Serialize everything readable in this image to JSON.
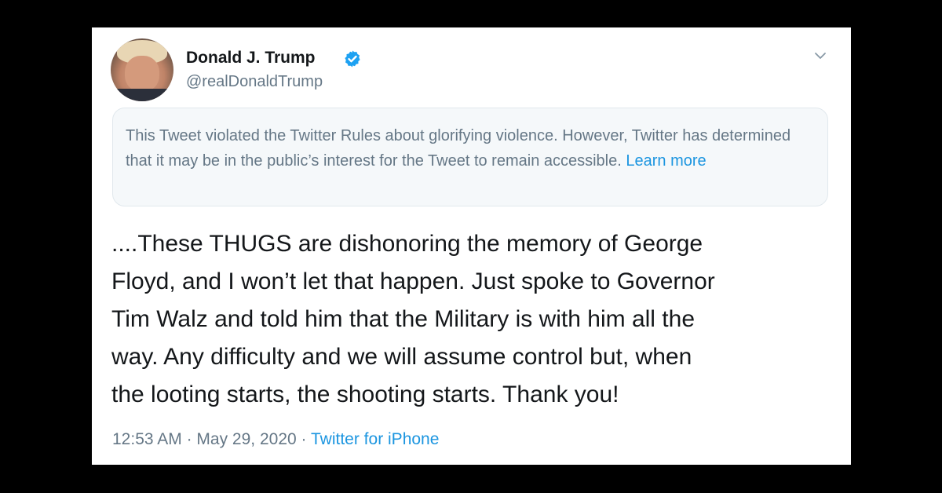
{
  "tweet": {
    "author": {
      "display_name": "Donald J. Trump",
      "handle": "@realDonaldTrump",
      "verified_icon": "verified-badge-icon",
      "avatar": "profile-photo"
    },
    "menu_icon": "chevron-down-icon",
    "notice": {
      "text": "This Tweet violated the Twitter Rules about glorifying violence. However, Twitter has determined that it may be in the public’s interest for the Tweet to remain accessible.",
      "link_label": "Learn more"
    },
    "text_lines": [
      "....These THUGS are dishonoring the memory of George",
      "Floyd, and I won’t let that happen. Just spoke to Governor",
      "Tim Walz and told him that the Military is with him all the",
      "way. Any difficulty and we will assume control but, when",
      "the looting starts, the shooting starts. Thank you!"
    ],
    "meta": {
      "time": "12:53 AM",
      "separator": "·",
      "date": "May 29, 2020",
      "source": "Twitter for iPhone"
    }
  },
  "colors": {
    "background": "#000000",
    "card": "#ffffff",
    "link": "#1b95e0",
    "secondary_text": "#657786",
    "primary_text": "#14171a",
    "notice_bg": "#f5f8fa"
  }
}
